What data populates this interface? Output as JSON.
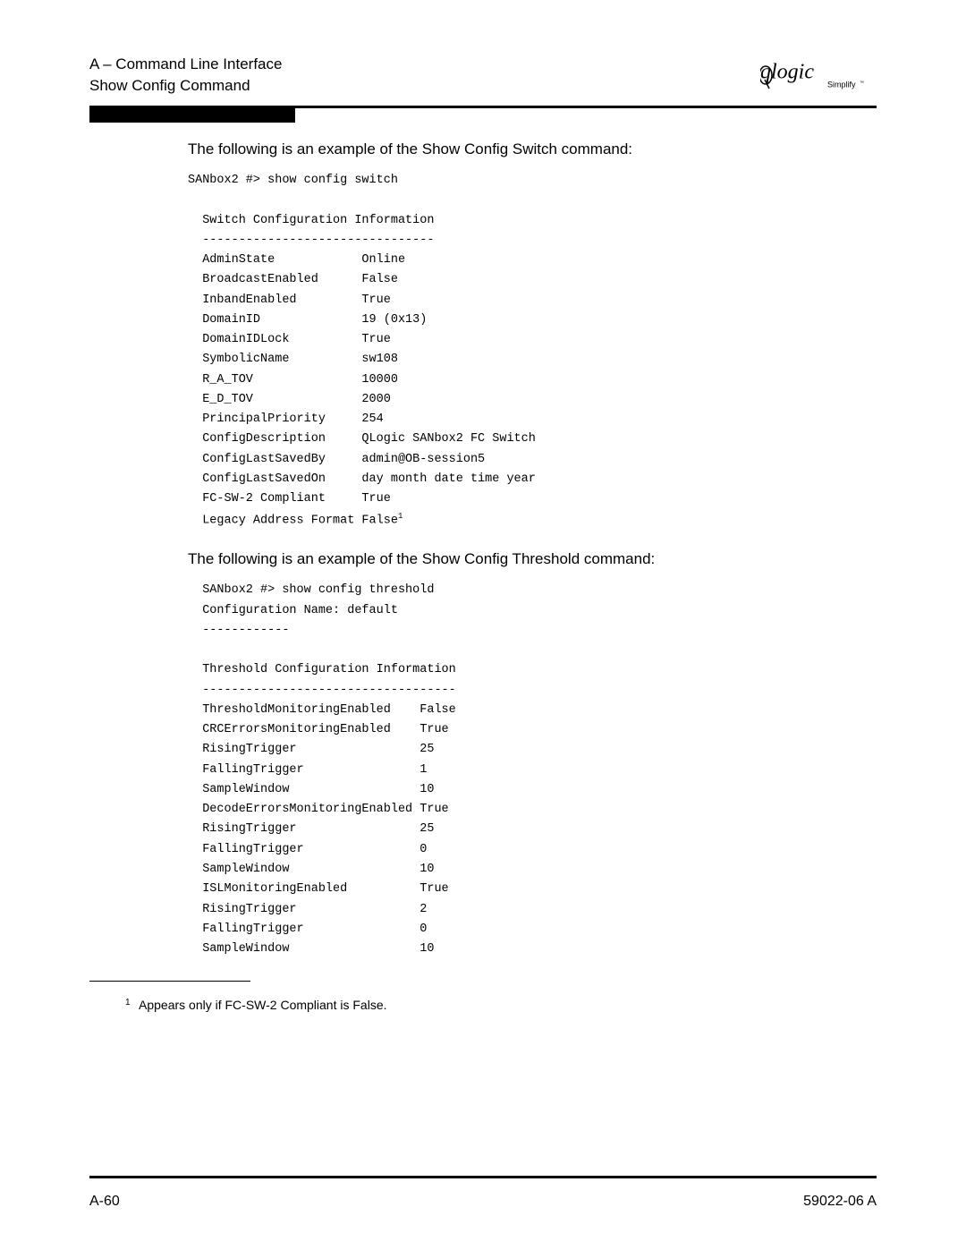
{
  "header": {
    "section": "A – Command Line Interface",
    "subtitle": "Show Config Command"
  },
  "logo": {
    "brand": "qlogic",
    "tagline": "Simplify"
  },
  "body": {
    "intro_switch": "The following is an example of the Show Config Switch command:",
    "cli_switch": "SANbox2 #> show config switch\n\n  Switch Configuration Information\n  --------------------------------\n  AdminState            Online\n  BroadcastEnabled      False\n  InbandEnabled         True\n  DomainID              19 (0x13)\n  DomainIDLock          True\n  SymbolicName          sw108\n  R_A_TOV               10000\n  E_D_TOV               2000\n  PrincipalPriority     254\n  ConfigDescription     QLogic SANbox2 FC Switch\n  ConfigLastSavedBy     admin@OB-session5\n  ConfigLastSavedOn     day month date time year\n  FC-SW-2 Compliant     True\n  Legacy Address Format False",
    "cli_switch_sup": "1",
    "intro_threshold": "The following is an example of the Show Config Threshold command:",
    "cli_threshold": "  SANbox2 #> show config threshold\n  Configuration Name: default \n  ------------\n\n  Threshold Configuration Information\n  -----------------------------------\n  ThresholdMonitoringEnabled    False\n  CRCErrorsMonitoringEnabled    True\n  RisingTrigger                 25\n  FallingTrigger                1\n  SampleWindow                  10\n  DecodeErrorsMonitoringEnabled True\n  RisingTrigger                 25\n  FallingTrigger                0\n  SampleWindow                  10\n  ISLMonitoringEnabled          True\n  RisingTrigger                 2\n  FallingTrigger                0\n  SampleWindow                  10"
  },
  "footnote": {
    "num": "1",
    "text": "Appears only if FC-SW-2 Compliant is False."
  },
  "footer": {
    "page": "A-60",
    "docnum": "59022-06  A"
  }
}
